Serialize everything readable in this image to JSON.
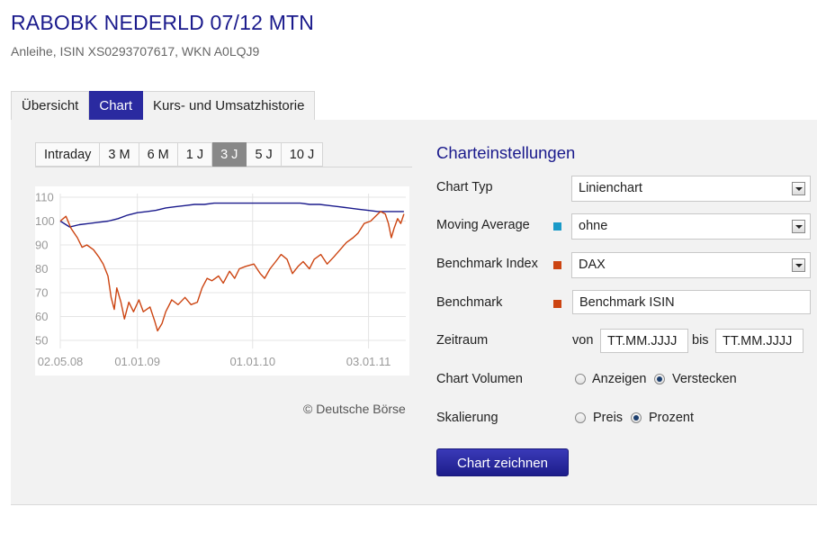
{
  "header": {
    "title": "RABOBK NEDERLD 07/12 MTN",
    "subtitle": "Anleihe, ISIN XS0293707617, WKN A0LQJ9"
  },
  "tabs": [
    {
      "label": "Übersicht",
      "active": false
    },
    {
      "label": "Chart",
      "active": true
    },
    {
      "label": "Kurs- und Umsatzhistorie",
      "active": false
    }
  ],
  "range_tabs": [
    {
      "label": "Intraday",
      "active": false
    },
    {
      "label": "3 M",
      "active": false
    },
    {
      "label": "6 M",
      "active": false
    },
    {
      "label": "1 J",
      "active": false
    },
    {
      "label": "3 J",
      "active": true
    },
    {
      "label": "5 J",
      "active": false
    },
    {
      "label": "10 J",
      "active": false
    }
  ],
  "chart_data": {
    "type": "line",
    "title": "",
    "xlabel": "",
    "ylabel": "",
    "ylim": [
      50,
      110
    ],
    "yticks": [
      110,
      100,
      90,
      80,
      70,
      60,
      50
    ],
    "grid": true,
    "xdomain": [
      "2008-05-02",
      "2011-05-01"
    ],
    "xticks": [
      {
        "date": "2008-05-02",
        "label": "02.05.08"
      },
      {
        "date": "2009-01-01",
        "label": "01.01.09"
      },
      {
        "date": "2010-01-01",
        "label": "01.01.10"
      },
      {
        "date": "2011-01-03",
        "label": "03.01.11"
      }
    ],
    "series": [
      {
        "color": "#1a1a8c",
        "points": [
          [
            "2008-05-02",
            100
          ],
          [
            "2008-06-01",
            97.5
          ],
          [
            "2008-07-01",
            98.5
          ],
          [
            "2008-08-01",
            99
          ],
          [
            "2008-09-01",
            99.5
          ],
          [
            "2008-10-01",
            100
          ],
          [
            "2008-11-01",
            101
          ],
          [
            "2008-12-01",
            102.5
          ],
          [
            "2009-01-01",
            103.5
          ],
          [
            "2009-02-01",
            104
          ],
          [
            "2009-03-01",
            104.5
          ],
          [
            "2009-04-01",
            105.5
          ],
          [
            "2009-05-01",
            106
          ],
          [
            "2009-06-01",
            106.5
          ],
          [
            "2009-07-01",
            107
          ],
          [
            "2009-08-01",
            107
          ],
          [
            "2009-09-01",
            107.5
          ],
          [
            "2009-10-01",
            107.5
          ],
          [
            "2009-11-01",
            107.5
          ],
          [
            "2009-12-01",
            107.5
          ],
          [
            "2010-01-01",
            107.5
          ],
          [
            "2010-02-01",
            107.5
          ],
          [
            "2010-03-01",
            107.5
          ],
          [
            "2010-04-01",
            107.5
          ],
          [
            "2010-05-01",
            107.5
          ],
          [
            "2010-06-01",
            107.5
          ],
          [
            "2010-07-01",
            107
          ],
          [
            "2010-08-01",
            107
          ],
          [
            "2010-09-01",
            106.5
          ],
          [
            "2010-10-01",
            106
          ],
          [
            "2010-11-01",
            105.5
          ],
          [
            "2010-12-01",
            105
          ],
          [
            "2011-01-01",
            104.5
          ],
          [
            "2011-02-01",
            104
          ],
          [
            "2011-03-01",
            104
          ],
          [
            "2011-04-01",
            104
          ],
          [
            "2011-04-25",
            104
          ]
        ]
      },
      {
        "color": "#cc4411",
        "points": [
          [
            "2008-05-02",
            100
          ],
          [
            "2008-05-20",
            102
          ],
          [
            "2008-06-05",
            97
          ],
          [
            "2008-06-25",
            93
          ],
          [
            "2008-07-10",
            89
          ],
          [
            "2008-07-25",
            90
          ],
          [
            "2008-08-15",
            88
          ],
          [
            "2008-09-01",
            85
          ],
          [
            "2008-09-15",
            82
          ],
          [
            "2008-09-30",
            77
          ],
          [
            "2008-10-10",
            68
          ],
          [
            "2008-10-20",
            63
          ],
          [
            "2008-10-28",
            72
          ],
          [
            "2008-11-10",
            66
          ],
          [
            "2008-11-21",
            59
          ],
          [
            "2008-12-05",
            66
          ],
          [
            "2008-12-20",
            62
          ],
          [
            "2009-01-06",
            67
          ],
          [
            "2009-01-20",
            62
          ],
          [
            "2009-02-10",
            64
          ],
          [
            "2009-02-25",
            58
          ],
          [
            "2009-03-06",
            54
          ],
          [
            "2009-03-20",
            57
          ],
          [
            "2009-04-01",
            62
          ],
          [
            "2009-04-20",
            67
          ],
          [
            "2009-05-10",
            65
          ],
          [
            "2009-06-01",
            68
          ],
          [
            "2009-06-20",
            65
          ],
          [
            "2009-07-10",
            66
          ],
          [
            "2009-07-25",
            72
          ],
          [
            "2009-08-10",
            76
          ],
          [
            "2009-08-25",
            75
          ],
          [
            "2009-09-15",
            77
          ],
          [
            "2009-09-30",
            74
          ],
          [
            "2009-10-20",
            79
          ],
          [
            "2009-11-05",
            76
          ],
          [
            "2009-11-20",
            80
          ],
          [
            "2009-12-10",
            81
          ],
          [
            "2010-01-05",
            82
          ],
          [
            "2010-01-25",
            78
          ],
          [
            "2010-02-08",
            76
          ],
          [
            "2010-02-25",
            80
          ],
          [
            "2010-03-15",
            83
          ],
          [
            "2010-04-01",
            86
          ],
          [
            "2010-04-20",
            84
          ],
          [
            "2010-05-07",
            78
          ],
          [
            "2010-05-25",
            81
          ],
          [
            "2010-06-10",
            83
          ],
          [
            "2010-06-30",
            80
          ],
          [
            "2010-07-15",
            84
          ],
          [
            "2010-08-05",
            86
          ],
          [
            "2010-08-25",
            82
          ],
          [
            "2010-09-15",
            85
          ],
          [
            "2010-10-05",
            88
          ],
          [
            "2010-10-25",
            91
          ],
          [
            "2010-11-15",
            93
          ],
          [
            "2010-12-01",
            95
          ],
          [
            "2010-12-20",
            99
          ],
          [
            "2011-01-10",
            100
          ],
          [
            "2011-01-25",
            102
          ],
          [
            "2011-02-10",
            104
          ],
          [
            "2011-02-25",
            103
          ],
          [
            "2011-03-07",
            99
          ],
          [
            "2011-03-16",
            93
          ],
          [
            "2011-03-25",
            97
          ],
          [
            "2011-04-05",
            101
          ],
          [
            "2011-04-15",
            99
          ],
          [
            "2011-04-25",
            103
          ]
        ]
      }
    ]
  },
  "copyright": "© Deutsche Börse",
  "settings": {
    "title": "Charteinstellungen",
    "chart_type": {
      "label": "Chart Typ",
      "value": "Linienchart"
    },
    "moving_average": {
      "label": "Moving Average",
      "value": "ohne",
      "color": "#1a9ac8"
    },
    "benchmark_index": {
      "label": "Benchmark Index",
      "value": "DAX",
      "color": "#cc4411"
    },
    "benchmark": {
      "label": "Benchmark",
      "placeholder": "Benchmark ISIN",
      "color": "#cc4411"
    },
    "zeitraum": {
      "label": "Zeitraum",
      "from_label": "von",
      "from_placeholder": "TT.MM.JJJJ",
      "to_label": "bis",
      "to_placeholder": "TT.MM.JJJJ"
    },
    "chart_volumen": {
      "label": "Chart Volumen",
      "option_show": "Anzeigen",
      "option_hide": "Verstecken",
      "selected": "Verstecken"
    },
    "skalierung": {
      "label": "Skalierung",
      "option_price": "Preis",
      "option_percent": "Prozent",
      "selected": "Prozent"
    },
    "draw_button": "Chart zeichnen"
  }
}
